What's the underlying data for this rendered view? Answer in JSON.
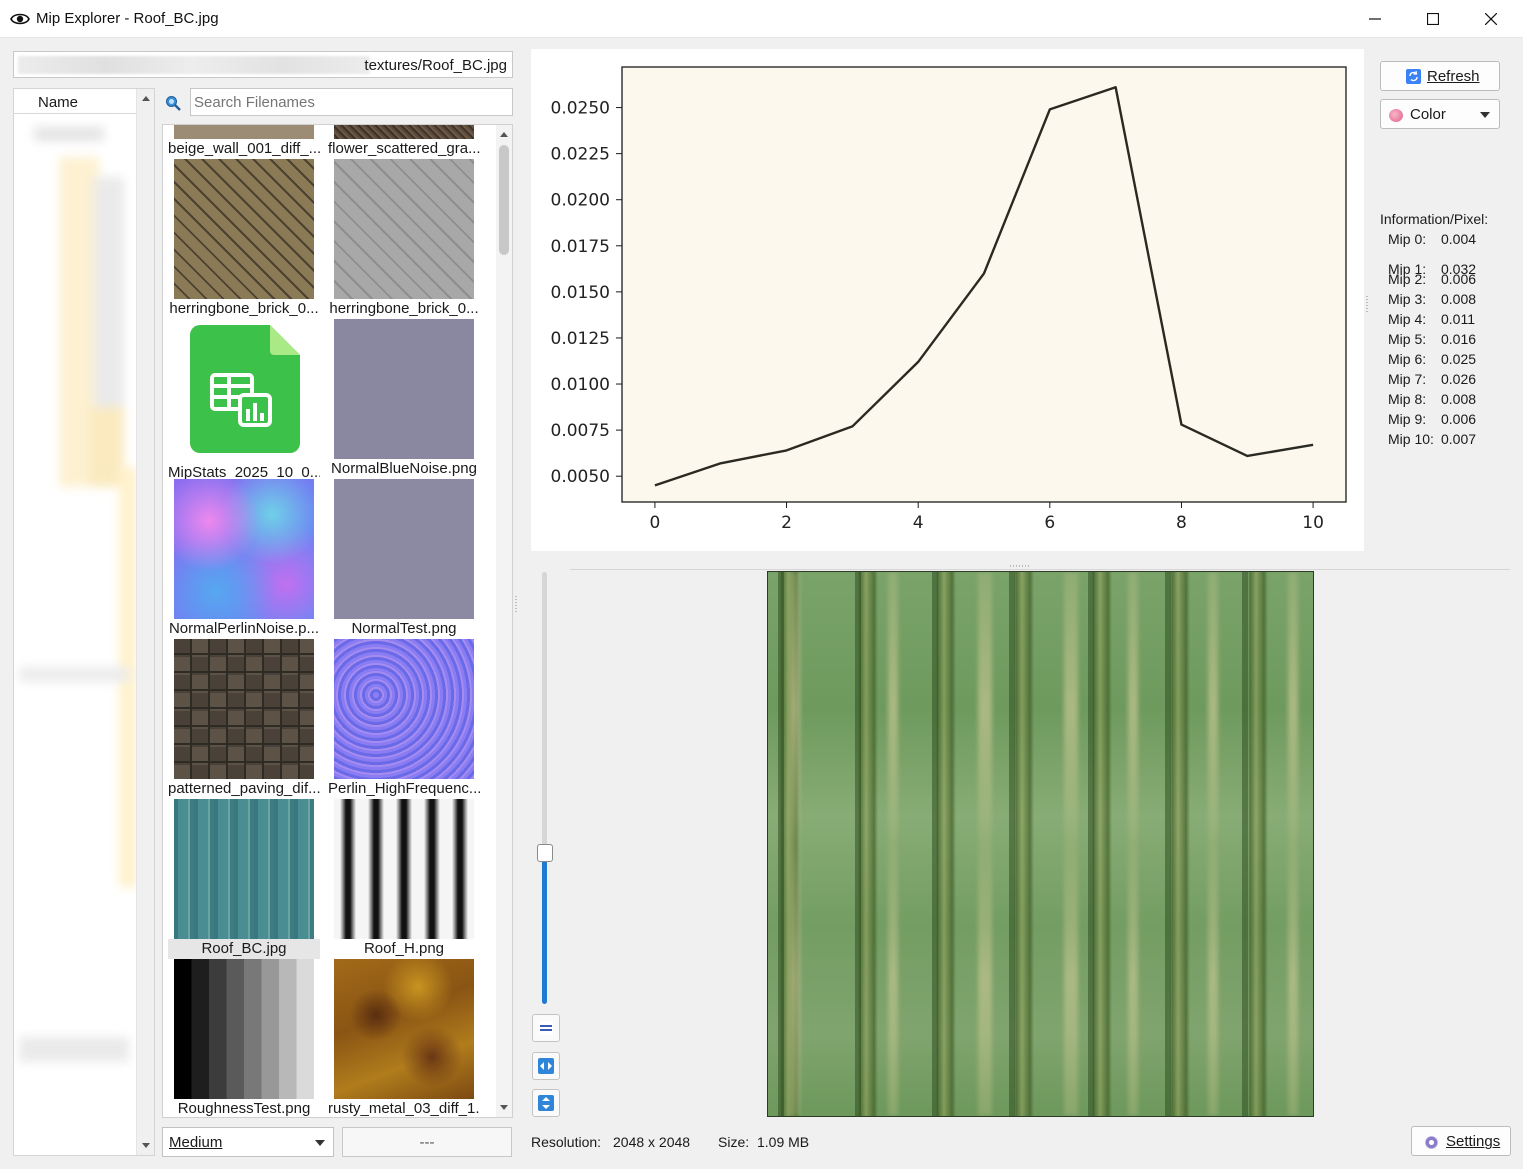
{
  "window": {
    "title": "Mip Explorer - Roof_BC.jpg",
    "minimize": "─",
    "maximize": "☐",
    "close": "✕"
  },
  "path": {
    "text": "textures/Roof_BC.jpg"
  },
  "tree": {
    "column_header": "Name"
  },
  "search": {
    "placeholder": "Search Filenames"
  },
  "thumbnails": [
    {
      "label": "beige_wall_001_diff_..."
    },
    {
      "label": "flower_scattered_gra..."
    },
    {
      "label": "herringbone_brick_0..."
    },
    {
      "label": "herringbone_brick_0..."
    },
    {
      "label": "MipStats_2025_10_0..."
    },
    {
      "label": "NormalBlueNoise.png"
    },
    {
      "label": "NormalPerlinNoise.p..."
    },
    {
      "label": "NormalTest.png"
    },
    {
      "label": "patterned_paving_dif..."
    },
    {
      "label": "Perlin_HighFrequenc..."
    },
    {
      "label": "Roof_BC.jpg"
    },
    {
      "label": "Roof_H.png"
    },
    {
      "label": "RoughnessTest.png"
    },
    {
      "label": "rusty_metal_03_diff_1..."
    }
  ],
  "bottom_left": {
    "quality": "Medium",
    "dash_button": "---"
  },
  "buttons": {
    "refresh": "Refresh",
    "color": "Color",
    "settings": "Settings"
  },
  "info": {
    "title": "Information/Pixel:",
    "mips": [
      {
        "label": "Mip 0:",
        "value": "0.004"
      },
      {
        "label": "Mip 1:",
        "value": "0.032"
      },
      {
        "label": "Mip 2:",
        "value": "0.006"
      },
      {
        "label": "Mip 3:",
        "value": "0.008"
      },
      {
        "label": "Mip 4:",
        "value": "0.011"
      },
      {
        "label": "Mip 5:",
        "value": "0.016"
      },
      {
        "label": "Mip 6:",
        "value": "0.025"
      },
      {
        "label": "Mip 7:",
        "value": "0.026"
      },
      {
        "label": "Mip 8:",
        "value": "0.008"
      },
      {
        "label": "Mip 9:",
        "value": "0.006"
      },
      {
        "label": "Mip 10:",
        "value": "0.007"
      }
    ]
  },
  "status": {
    "resolution_label": "Resolution:",
    "resolution_value": "2048 x 2048",
    "size_label": "Size:",
    "size_value": "1.09 MB"
  },
  "viewer": {
    "mip_level": 0.35
  },
  "colors": {
    "plot_bg": "#fcf8ee",
    "line": "#2a2a22",
    "accent": "#1f7ad1"
  },
  "chart_data": {
    "type": "line",
    "x": [
      0,
      1,
      2,
      3,
      4,
      5,
      6,
      7,
      8,
      9,
      10
    ],
    "series": [
      {
        "values": [
          0.0045,
          0.0057,
          0.0064,
          0.0077,
          0.0112,
          0.016,
          0.0249,
          0.0261,
          0.0078,
          0.0061,
          0.0067
        ]
      }
    ],
    "xticks": [
      "0",
      "2",
      "4",
      "6",
      "8",
      "10"
    ],
    "yticks": [
      "0.0050",
      "0.0075",
      "0.0100",
      "0.0125",
      "0.0150",
      "0.0175",
      "0.0200",
      "0.0225",
      "0.0250"
    ],
    "xlim": [
      -0.5,
      10.5
    ],
    "ylim": [
      0.0036,
      0.0272
    ],
    "grid": false
  }
}
